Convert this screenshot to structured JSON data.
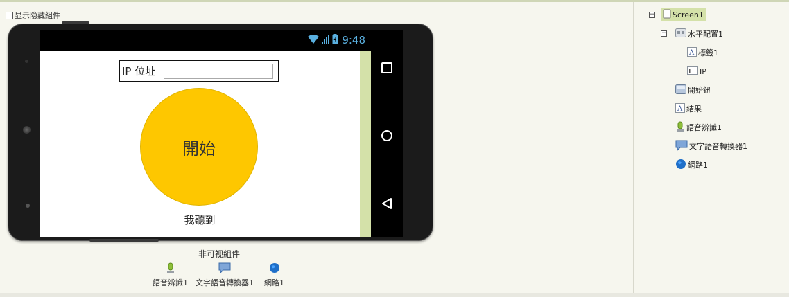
{
  "viewer": {
    "show_hidden_label": "显示隐藏組件",
    "status_time": "9:48",
    "screen": {
      "ip_label": "IP 位址",
      "ip_input_value": "",
      "start_button_label": "開始",
      "result_label": "我聽到"
    },
    "nonvisible": {
      "title": "非可视組件",
      "items": [
        {
          "label": "語音辨識1",
          "icon": "microphone-icon"
        },
        {
          "label": "文字語音轉換器1",
          "icon": "speech-bubble-icon"
        },
        {
          "label": "網路1",
          "icon": "globe-icon"
        }
      ]
    }
  },
  "tree": {
    "screen1": "Screen1",
    "hbox": "水平配置1",
    "label1": "標籤1",
    "ip": "IP",
    "start_button": "開始鈕",
    "result": "結果",
    "speech_recognizer": "語音辨識1",
    "tts": "文字語音轉換器1",
    "web": "網路1"
  },
  "colors": {
    "accent": "#d4e1a9",
    "button": "#fec700",
    "clock": "#5ab0e0",
    "background": "#f6f6ee"
  }
}
